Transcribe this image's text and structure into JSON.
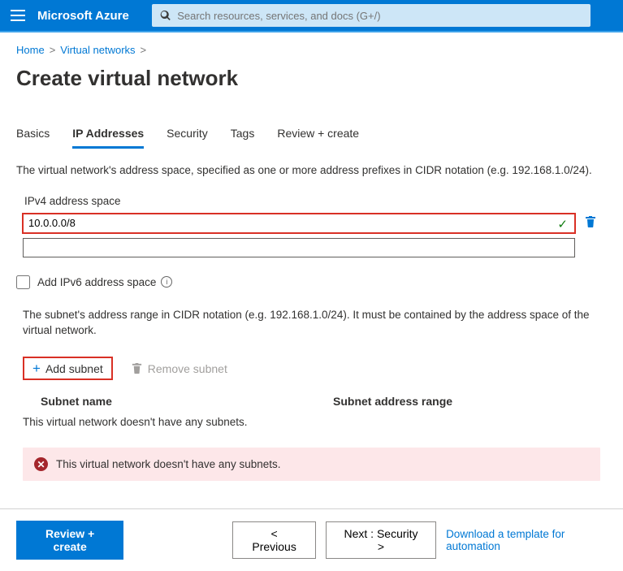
{
  "header": {
    "brand": "Microsoft Azure",
    "search_placeholder": "Search resources, services, and docs (G+/)"
  },
  "breadcrumb": {
    "home": "Home",
    "section": "Virtual networks"
  },
  "page_title": "Create virtual network",
  "tabs": {
    "basics": "Basics",
    "ip": "IP Addresses",
    "security": "Security",
    "tags": "Tags",
    "review": "Review + create"
  },
  "ipv4": {
    "description": "The virtual network's address space, specified as one or more address prefixes in CIDR notation (e.g. 192.168.1.0/24).",
    "label": "IPv4 address space",
    "value": "10.0.0.0/8"
  },
  "ipv6": {
    "checkbox_label": "Add IPv6 address space"
  },
  "subnet": {
    "description": "The subnet's address range in CIDR notation (e.g. 192.168.1.0/24). It must be contained by the address space of the virtual network.",
    "add_label": "Add subnet",
    "remove_label": "Remove subnet",
    "col_name": "Subnet name",
    "col_range": "Subnet address range",
    "empty_text": "This virtual network doesn't have any subnets."
  },
  "alert": {
    "message": "This virtual network doesn't have any subnets."
  },
  "footer": {
    "review": "Review + create",
    "previous": "< Previous",
    "next": "Next : Security >",
    "download": "Download a template for automation"
  }
}
